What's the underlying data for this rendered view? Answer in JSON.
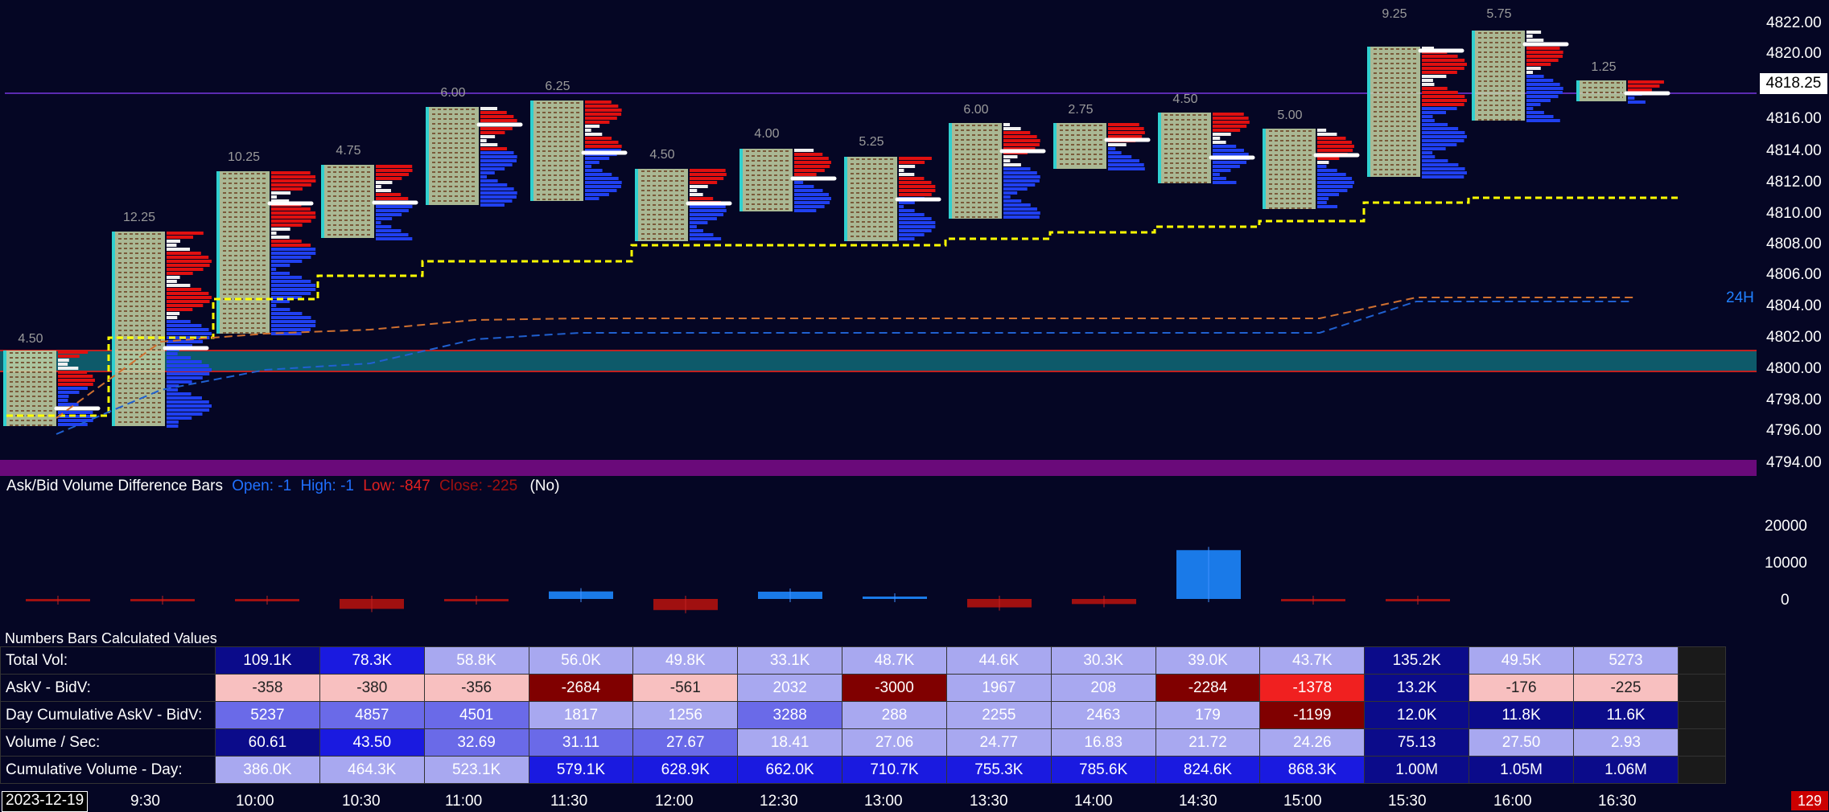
{
  "price_axis": {
    "ticks": [
      "4822.00",
      "4820.00",
      "4818.25",
      "4816.00",
      "4814.00",
      "4812.00",
      "4810.00",
      "4808.00",
      "4806.00",
      "4804.00",
      "4802.00",
      "4800.00",
      "4798.00",
      "4796.00",
      "4794.00"
    ],
    "current_price": "4818.25"
  },
  "bar_labels": [
    "4.50",
    "12.25",
    "10.25",
    "4.75",
    "6.00",
    "6.25",
    "4.50",
    "4.00",
    "5.25",
    "6.00",
    "2.75",
    "4.50",
    "5.00",
    "9.25",
    "5.75",
    "1.25"
  ],
  "session_label": "24H",
  "colors": {
    "background": "#050624",
    "vpoc_line": "#ffff00",
    "value_band": "#0e5a6a",
    "bid_bar": "#2040f0",
    "ask_bar": "#e01010",
    "study_band": "#6a0a7a"
  },
  "study": {
    "title": "Ask/Bid Volume Difference Bars",
    "open": "Open: -1",
    "high": "High: -1",
    "low": "Low: -847",
    "close": "Close: -225",
    "mode": "(No)",
    "axis_ticks": [
      "20000",
      "10000",
      "0"
    ]
  },
  "numbers_bars": {
    "title": "Numbers Bars Calculated Values",
    "rows": [
      {
        "label": "Total Vol:",
        "cells": [
          "109.1K",
          "78.3K",
          "58.8K",
          "56.0K",
          "49.8K",
          "33.1K",
          "48.7K",
          "44.6K",
          "30.3K",
          "39.0K",
          "43.7K",
          "135.2K",
          "49.5K",
          "5273"
        ]
      },
      {
        "label": "AskV - BidV:",
        "cells": [
          "-358",
          "-380",
          "-356",
          "-2684",
          "-561",
          "2032",
          "-3000",
          "1967",
          "208",
          "-2284",
          "-1378",
          "13.2K",
          "-176",
          "-225"
        ]
      },
      {
        "label": "Day Cumulative AskV - BidV:",
        "cells": [
          "5237",
          "4857",
          "4501",
          "1817",
          "1256",
          "3288",
          "288",
          "2255",
          "2463",
          "179",
          "-1199",
          "12.0K",
          "11.8K",
          "11.6K"
        ]
      },
      {
        "label": "Volume / Sec:",
        "cells": [
          "60.61",
          "43.50",
          "32.69",
          "31.11",
          "27.67",
          "18.41",
          "27.06",
          "24.77",
          "16.83",
          "21.72",
          "24.26",
          "75.13",
          "27.50",
          "2.93"
        ]
      },
      {
        "label": "Cumulative Volume - Day:",
        "cells": [
          "386.0K",
          "464.3K",
          "523.1K",
          "579.1K",
          "628.9K",
          "662.0K",
          "710.7K",
          "755.3K",
          "785.6K",
          "824.6K",
          "868.3K",
          "1.00M",
          "1.05M",
          "1.06M"
        ]
      }
    ]
  },
  "time_axis": {
    "date": "2023-12-19",
    "labels": [
      "9:30",
      "10:00",
      "10:30",
      "11:00",
      "11:30",
      "12:00",
      "12:30",
      "13:00",
      "13:30",
      "14:00",
      "14:30",
      "15:00",
      "15:30",
      "16:00",
      "16:30"
    ]
  },
  "corner_badge": "129"
}
